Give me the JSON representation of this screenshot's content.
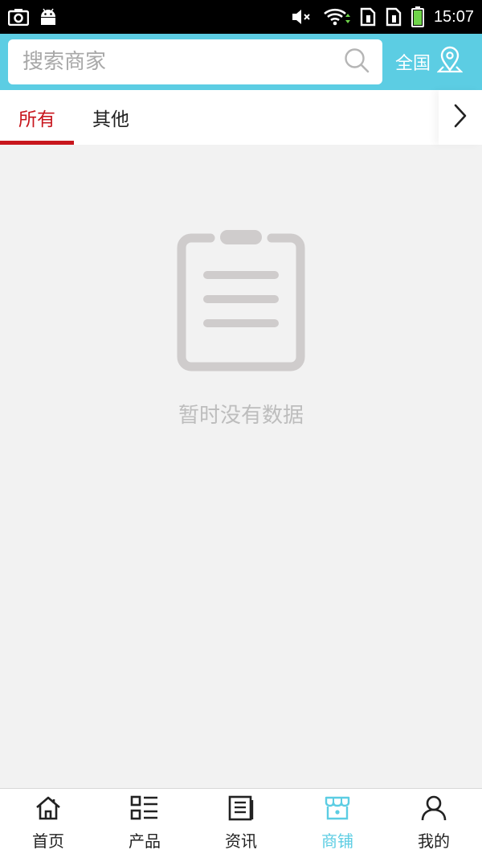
{
  "status_bar": {
    "time": "15:07",
    "icons": [
      "camera-icon",
      "android-icon",
      "mute-icon",
      "wifi-icon",
      "sim-icon",
      "sim-icon",
      "battery-icon"
    ]
  },
  "header": {
    "search": {
      "placeholder": "搜索商家",
      "value": "",
      "icon": "search-icon"
    },
    "region": {
      "label": "全国",
      "icon": "location-pin-icon"
    }
  },
  "tabs": {
    "items": [
      {
        "label": "所有",
        "active": true
      },
      {
        "label": "其他",
        "active": false
      }
    ],
    "more_icon": "chevron-right-icon"
  },
  "empty_state": {
    "icon": "clipboard-icon",
    "message": "暂时没有数据"
  },
  "bottom_nav": {
    "items": [
      {
        "label": "首页",
        "icon": "home-icon",
        "active": false
      },
      {
        "label": "产品",
        "icon": "list-grid-icon",
        "active": false
      },
      {
        "label": "资讯",
        "icon": "news-icon",
        "active": false
      },
      {
        "label": "商铺",
        "icon": "store-icon",
        "active": true
      },
      {
        "label": "我的",
        "icon": "user-icon",
        "active": false
      }
    ]
  },
  "colors": {
    "accent": "#5ccde3",
    "tab_active": "#c8161d",
    "background": "#f2f2f2",
    "empty_gray": "#cfcccc"
  }
}
